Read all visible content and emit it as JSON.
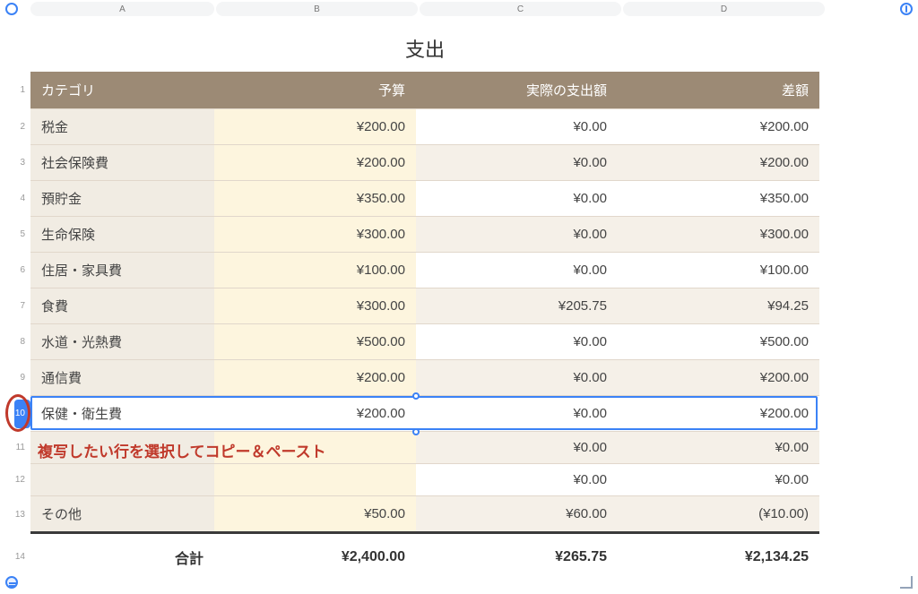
{
  "columns": {
    "A": "A",
    "B": "B",
    "C": "C",
    "D": "D"
  },
  "title": "支出",
  "header": {
    "category": "カテゴリ",
    "budget": "予算",
    "actual": "実際の支出額",
    "diff": "差額"
  },
  "rows": [
    {
      "n": "1",
      "cat": "",
      "bud": "",
      "act": "",
      "diff": "",
      "is_header": true
    },
    {
      "n": "2",
      "cat": "税金",
      "bud": "¥200.00",
      "act": "¥0.00",
      "diff": "¥200.00"
    },
    {
      "n": "3",
      "cat": "社会保険費",
      "bud": "¥200.00",
      "act": "¥0.00",
      "diff": "¥200.00"
    },
    {
      "n": "4",
      "cat": "預貯金",
      "bud": "¥350.00",
      "act": "¥0.00",
      "diff": "¥350.00"
    },
    {
      "n": "5",
      "cat": "生命保険",
      "bud": "¥300.00",
      "act": "¥0.00",
      "diff": "¥300.00"
    },
    {
      "n": "6",
      "cat": "住居・家具費",
      "bud": "¥100.00",
      "act": "¥0.00",
      "diff": "¥100.00"
    },
    {
      "n": "7",
      "cat": "食費",
      "bud": "¥300.00",
      "act": "¥205.75",
      "diff": "¥94.25"
    },
    {
      "n": "8",
      "cat": "水道・光熱費",
      "bud": "¥500.00",
      "act": "¥0.00",
      "diff": "¥500.00"
    },
    {
      "n": "9",
      "cat": "通信費",
      "bud": "¥200.00",
      "act": "¥0.00",
      "diff": "¥200.00"
    },
    {
      "n": "10",
      "cat": "保健・衛生費",
      "bud": "¥200.00",
      "act": "¥0.00",
      "diff": "¥200.00",
      "selected": true
    },
    {
      "n": "11",
      "cat": "",
      "bud": "",
      "act": "¥0.00",
      "diff": "¥0.00"
    },
    {
      "n": "12",
      "cat": "",
      "bud": "",
      "act": "¥0.00",
      "diff": "¥0.00"
    },
    {
      "n": "13",
      "cat": "その他",
      "bud": "¥50.00",
      "act": "¥60.00",
      "diff": "(¥10.00)",
      "neg": true
    }
  ],
  "total": {
    "label": "合計",
    "bud": "¥2,400.00",
    "act": "¥265.75",
    "diff": "¥2,134.25",
    "n": "14"
  },
  "annotation": "複写したい行を選択してコピー＆ペースト"
}
